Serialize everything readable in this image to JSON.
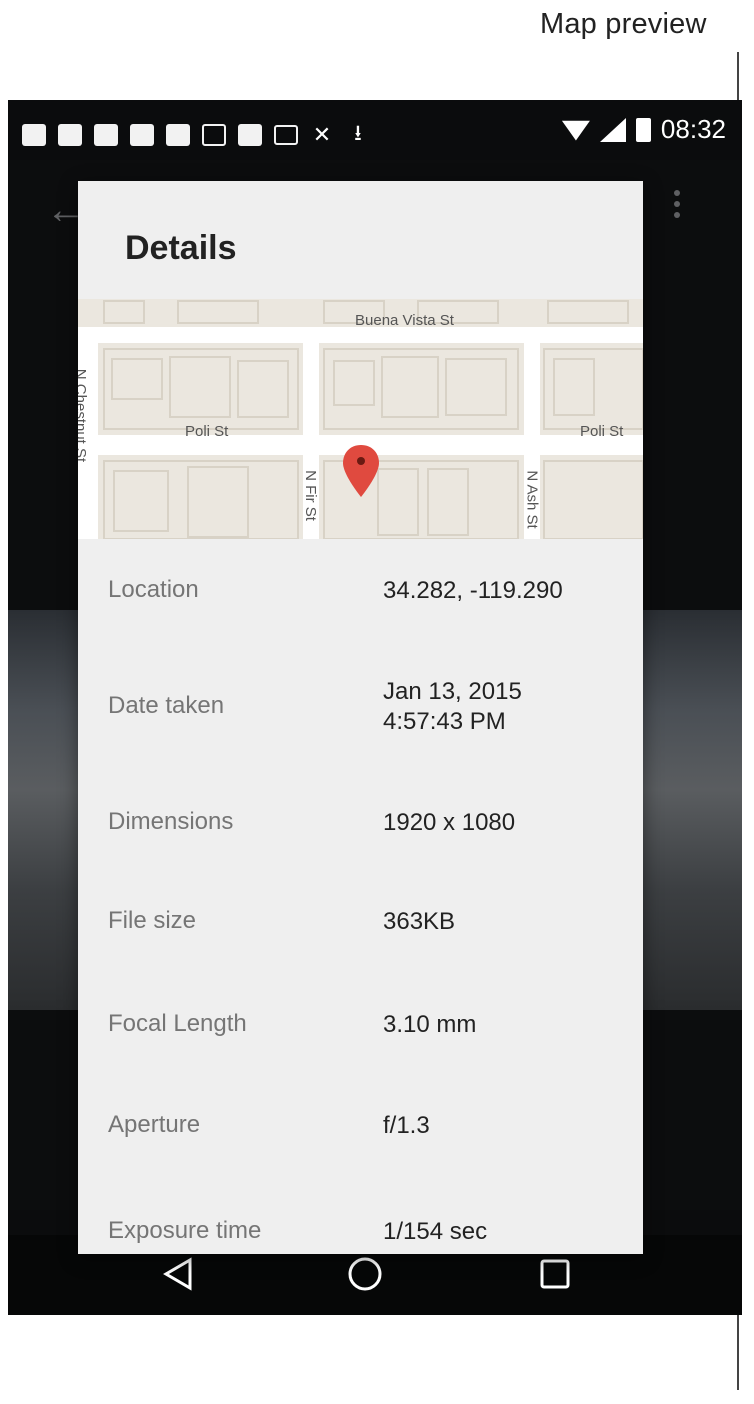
{
  "annotation": {
    "title": "Map preview"
  },
  "status_bar": {
    "time": "08:32",
    "notification_icons": [
      "message-icon",
      "chat-icon",
      "chat-icon",
      "chat-icon",
      "chat-icon",
      "gallery-icon",
      "voicemail-icon",
      "email-icon",
      "missed-call-icon",
      "download-icon"
    ]
  },
  "toolbar": {
    "back_icon": "arrow-left-icon",
    "overflow_icon": "overflow-menu-icon"
  },
  "dialog": {
    "title": "Details",
    "map": {
      "labels": {
        "buena_vista": "Buena Vista St",
        "poli_left": "Poli St",
        "poli_right": "Poli St",
        "chestnut": "N Chestnut St",
        "fir": "N Fir St",
        "ash": "N Ash St"
      },
      "pin_color": "#e04a3f"
    },
    "rows": [
      {
        "label": "Location",
        "value": "34.282, -119.290"
      },
      {
        "label": "Date taken",
        "value": "Jan 13, 2015\n4:57:43 PM"
      },
      {
        "label": "Dimensions",
        "value": "1920 x 1080"
      },
      {
        "label": "File size",
        "value": "363KB"
      },
      {
        "label": "Focal Length",
        "value": "3.10 mm"
      },
      {
        "label": "Aperture",
        "value": "f/1.3"
      },
      {
        "label": "Exposure time",
        "value": "1/154 sec"
      }
    ]
  },
  "nav_bar": {
    "back": "back-triangle-icon",
    "home": "home-circle-icon",
    "recents": "recents-square-icon"
  }
}
